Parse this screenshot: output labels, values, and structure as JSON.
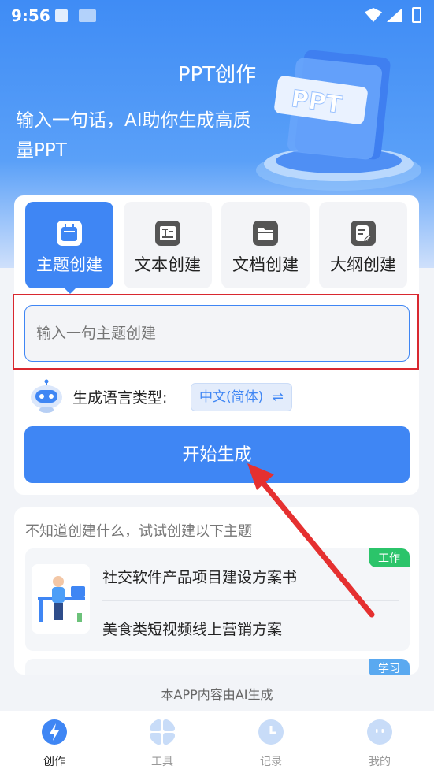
{
  "status": {
    "time": "9:56"
  },
  "hero": {
    "title": "PPT创作",
    "subtitle": "输入一句话，AI助你生成高质量PPT",
    "art_label": "PPT"
  },
  "tabs": [
    {
      "label": "主题创建",
      "active": true,
      "icon": "calendar-icon"
    },
    {
      "label": "文本创建",
      "active": false,
      "icon": "text-icon"
    },
    {
      "label": "文档创建",
      "active": false,
      "icon": "folder-icon"
    },
    {
      "label": "大纲创建",
      "active": false,
      "icon": "outline-edit-icon"
    }
  ],
  "topic_input": {
    "placeholder": "输入一句主题创建",
    "value": ""
  },
  "language": {
    "label": "生成语言类型:",
    "value": "中文(简体)",
    "switch_icon": "swap-icon"
  },
  "start_button": {
    "label": "开始生成"
  },
  "suggestions": {
    "hint": "不知道创建什么，试试创建以下主题",
    "groups": [
      {
        "tag": "工作",
        "tag_color": "#2bc46a",
        "items": [
          "社交软件产品项目建设方案书",
          "美食类短视频线上营销方案"
        ]
      },
      {
        "tag": "学习",
        "tag_color": "#5aa9f0",
        "items": []
      }
    ]
  },
  "footer_note": "本APP内容由AI生成",
  "bottom_nav": [
    {
      "label": "创作",
      "active": true,
      "icon": "lightning-icon"
    },
    {
      "label": "工具",
      "active": false,
      "icon": "grid-icon"
    },
    {
      "label": "记录",
      "active": false,
      "icon": "clock-icon"
    },
    {
      "label": "我的",
      "active": false,
      "icon": "chat-face-icon"
    }
  ],
  "colors": {
    "accent": "#3f86f4",
    "highlight": "#d9282f",
    "work_tag": "#2bc46a",
    "study_tag": "#5aa9f0"
  }
}
